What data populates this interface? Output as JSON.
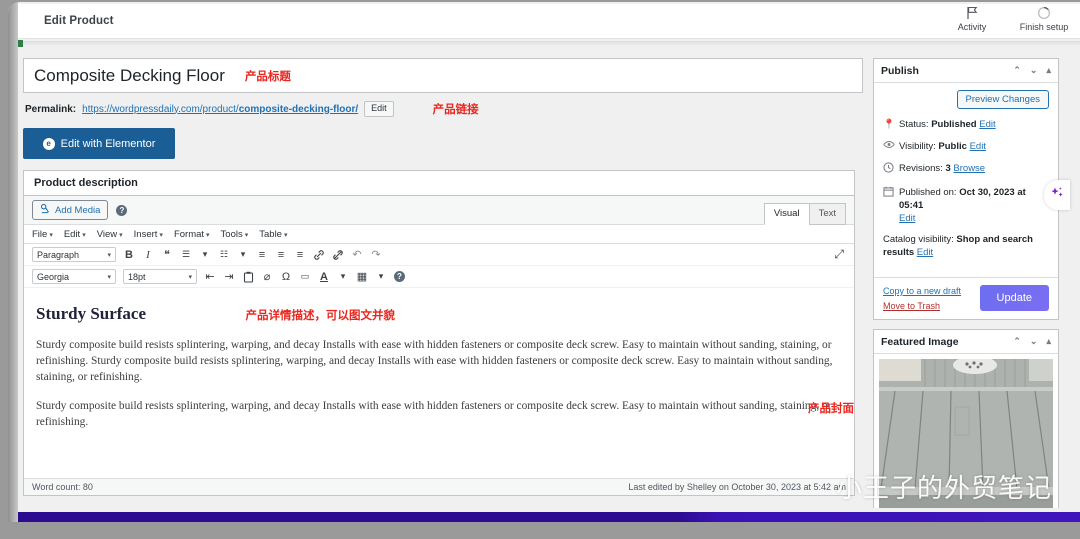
{
  "adminbar": {
    "title": "Edit Product",
    "items": [
      {
        "label": "Activity",
        "icon": "flag-icon"
      },
      {
        "label": "Finish setup",
        "icon": "progress-circle-icon"
      }
    ]
  },
  "product": {
    "title": "Composite Decking Floor",
    "title_annotation": "产品标题",
    "permalink_label": "Permalink:",
    "permalink_base": "https://wordpressdaily.com/product/",
    "permalink_slug": "composite-decking-floor/",
    "permalink_edit": "Edit",
    "permalink_annotation": "产品链接",
    "elementor_button": "Edit with Elementor",
    "elementor_badge": "e"
  },
  "editor": {
    "heading": "Product description",
    "add_media": "Add Media",
    "tabs": [
      {
        "label": "Visual",
        "active": true
      },
      {
        "label": "Text",
        "active": false
      }
    ],
    "menubar": [
      "File",
      "Edit",
      "View",
      "Insert",
      "Format",
      "Tools",
      "Table"
    ],
    "toolbar_row1": {
      "style_select": "Paragraph",
      "icons": [
        {
          "name": "bold-icon",
          "glyph": "B"
        },
        {
          "name": "italic-icon",
          "glyph": "I"
        },
        {
          "name": "blockquote-icon",
          "glyph": "❝"
        },
        {
          "name": "bullet-list-icon",
          "glyph": "☰"
        },
        {
          "name": "bullet-list-caret-icon",
          "glyph": "▾"
        },
        {
          "name": "numbered-list-icon",
          "glyph": "☷"
        },
        {
          "name": "numbered-list-caret-icon",
          "glyph": "▾"
        },
        {
          "name": "align-left-icon",
          "glyph": "≡"
        },
        {
          "name": "align-center-icon",
          "glyph": "≡"
        },
        {
          "name": "align-right-icon",
          "glyph": "≡"
        },
        {
          "name": "insert-link-icon",
          "glyph": "🔗"
        },
        {
          "name": "remove-link-icon",
          "glyph": "⛓"
        },
        {
          "name": "undo-icon",
          "glyph": "↶"
        },
        {
          "name": "redo-icon",
          "glyph": "↷"
        }
      ]
    },
    "toolbar_row2": {
      "font_select": "Georgia",
      "size_select": "18pt",
      "icons": [
        {
          "name": "decrease-indent-icon",
          "glyph": "⇤"
        },
        {
          "name": "increase-indent-icon",
          "glyph": "⇥"
        },
        {
          "name": "paste-as-text-icon",
          "glyph": "📋"
        },
        {
          "name": "clear-formatting-icon",
          "glyph": "⌀"
        },
        {
          "name": "special-character-icon",
          "glyph": "Ω"
        },
        {
          "name": "horizontal-rule-icon",
          "glyph": "▭"
        },
        {
          "name": "text-color-icon",
          "glyph": "A"
        },
        {
          "name": "text-color-caret-icon",
          "glyph": "▾"
        },
        {
          "name": "table-icon",
          "glyph": "▦"
        },
        {
          "name": "table-caret-icon",
          "glyph": "▾"
        },
        {
          "name": "keyboard-shortcuts-icon",
          "glyph": "?"
        }
      ]
    },
    "fullscreen_icon": "⤢",
    "document": {
      "heading": "Sturdy Surface",
      "heading_annotation": "产品详情描述，可以图文并貌",
      "paragraph1": "Sturdy composite build resists splintering, warping, and decay Installs with ease with hidden fasteners or composite deck screw. Easy to maintain without sanding, staining, or refinishing.  Sturdy composite build resists splintering, warping, and decay Installs with ease with hidden fasteners or composite deck screw. Easy to maintain without sanding, staining, or refinishing.",
      "paragraph2": "Sturdy composite build resists splintering, warping, and decay Installs with ease with hidden fasteners or composite deck screw. Easy to maintain without sanding, staining, or refinishing."
    },
    "word_count": "Word count: 80",
    "last_edited": "Last edited by Shelley on October 30, 2023 at 5:42 am"
  },
  "publish_panel": {
    "title": "Publish",
    "preview_button": "Preview Changes",
    "status_label": "Status:",
    "status_value": "Published",
    "status_edit": "Edit",
    "visibility_label": "Visibility:",
    "visibility_value": "Public",
    "visibility_edit": "Edit",
    "revisions_label": "Revisions:",
    "revisions_value": "3",
    "revisions_browse": "Browse",
    "published_label": "Published on:",
    "published_value": "Oct 30, 2023 at 05:41",
    "published_edit": "Edit",
    "catalog_label": "Catalog visibility:",
    "catalog_value": "Shop and search results",
    "catalog_edit": "Edit",
    "copy_draft": "Copy to a new draft",
    "move_trash": "Move to Trash",
    "update_button": "Update"
  },
  "featured_panel": {
    "title": "Featured Image",
    "image_alt": "gray composite decking floor planks",
    "annotation": "产品封面"
  },
  "ai_widget": {
    "icon": "sparkle-icon"
  },
  "watermark": {
    "text": "小王子的外贸笔记"
  },
  "colors": {
    "wp_blue": "#2271b1",
    "elementor_blue": "#1b5e96",
    "update_purple": "#6d6ef0",
    "annotation_red": "#e8271f",
    "trash_red": "#b32d2e",
    "bottom_bar": "#2b0b8f"
  }
}
